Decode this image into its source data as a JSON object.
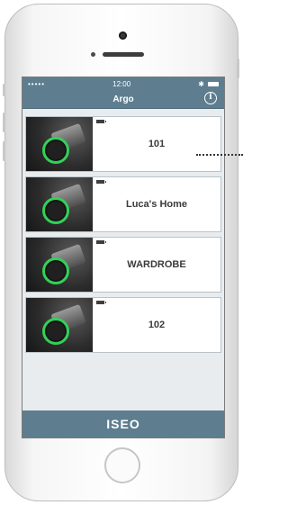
{
  "status_bar": {
    "signal": "•••••",
    "time": "12:00",
    "bluetooth_icon": "bluetooth-icon",
    "battery_icon": "battery-icon"
  },
  "nav": {
    "title": "Argo",
    "info_icon": "info-icon",
    "info_symbol": "i"
  },
  "locks": [
    {
      "name": "101",
      "thumbnail": "lock-cylinder-image",
      "battery_indicator": "battery-indicator-icon"
    },
    {
      "name": "Luca's Home",
      "thumbnail": "lock-cylinder-image",
      "battery_indicator": "battery-indicator-icon"
    },
    {
      "name": "WARDROBE",
      "thumbnail": "lock-cylinder-image",
      "battery_indicator": "battery-indicator-icon"
    },
    {
      "name": "102",
      "thumbnail": "lock-cylinder-image",
      "battery_indicator": "battery-indicator-icon"
    }
  ],
  "footer": {
    "logo_text": "ISEO"
  },
  "colors": {
    "bar": "#5e7e90",
    "ring": "#32d158",
    "screen_bg": "#e8ecee"
  }
}
